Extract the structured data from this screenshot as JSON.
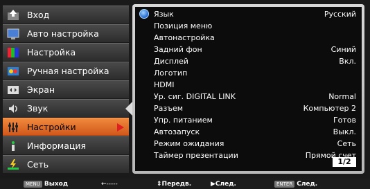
{
  "menu": [
    {
      "label": "Вход",
      "icon": "input-icon"
    },
    {
      "label": "Авто настройка",
      "icon": "auto-setup-icon"
    },
    {
      "label": "Настройка",
      "icon": "adjust-icon"
    },
    {
      "label": "Ручная настройка",
      "icon": "manual-adjust-icon"
    },
    {
      "label": "Экран",
      "icon": "screen-icon"
    },
    {
      "label": "Звук",
      "icon": "sound-icon"
    },
    {
      "label": "Настройки",
      "icon": "settings-icon",
      "active": true
    },
    {
      "label": "Информация",
      "icon": "info-icon"
    },
    {
      "label": "Сеть",
      "icon": "network-icon"
    }
  ],
  "settings": [
    {
      "label": "Язык",
      "value": "Русский"
    },
    {
      "label": "Позиция меню",
      "value": ""
    },
    {
      "label": "Автонастройка",
      "value": ""
    },
    {
      "label": "Задний фон",
      "value": "Синий"
    },
    {
      "label": "Дисплей",
      "value": "Вкл."
    },
    {
      "label": "Логотип",
      "value": ""
    },
    {
      "label": "HDMI",
      "value": ""
    },
    {
      "label": "Ур. сиг. DIGITAL LINK",
      "value": "Normal"
    },
    {
      "label": "Разъем",
      "value": "Компьютер 2"
    },
    {
      "label": "Упр. питанием",
      "value": "Готов"
    },
    {
      "label": "Автозапуск",
      "value": "Выкл."
    },
    {
      "label": "Режим ожидания",
      "value": "Сеть"
    },
    {
      "label": "Таймер презентации",
      "value": "Прямой счет"
    }
  ],
  "page_indicator": "1/2",
  "footer": {
    "menu_key": "MENU",
    "exit": "Выход",
    "back_arrow": "←-----",
    "prev": "⇕Передв.",
    "next_arrow": "▶След.",
    "enter_key": "ENTER",
    "enter_next": "След."
  },
  "colors": {
    "active": "#e0662a",
    "panel_border": "#c8c8c8"
  }
}
